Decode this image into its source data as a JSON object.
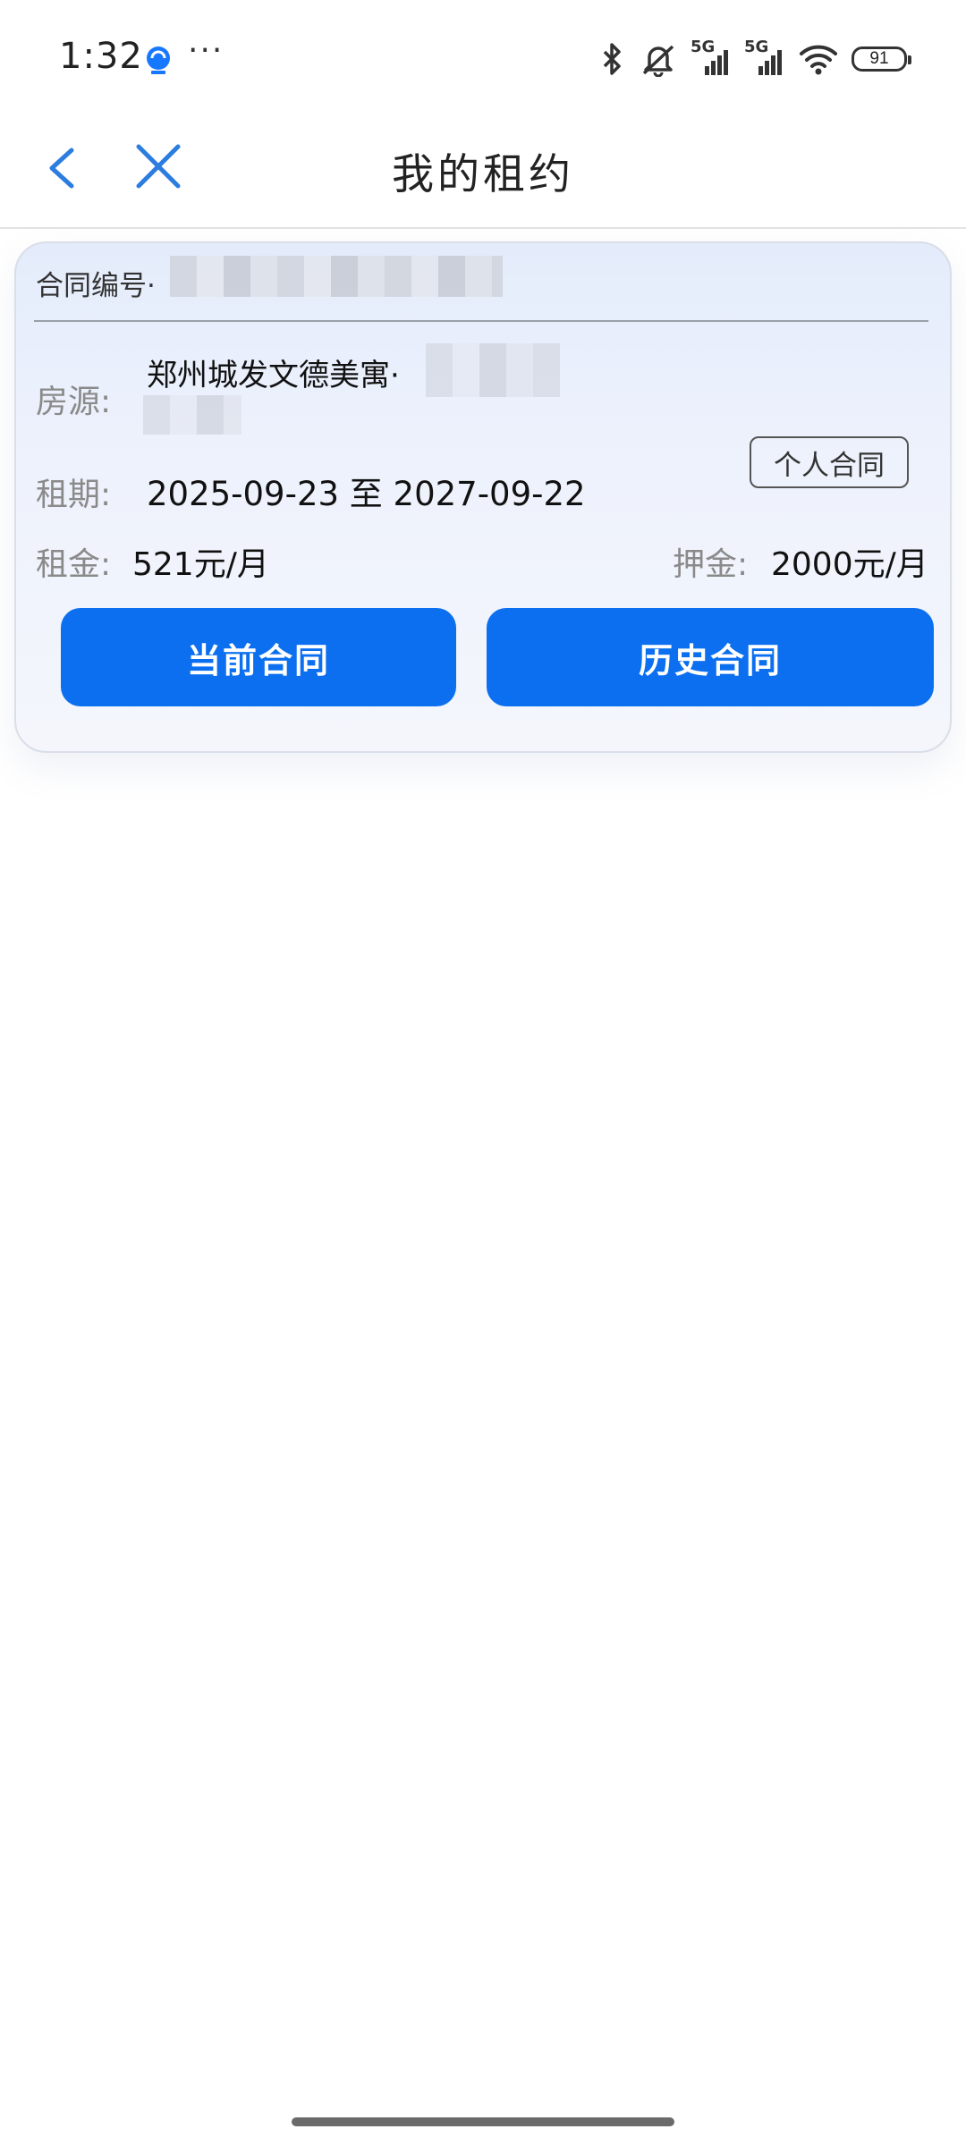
{
  "status_bar": {
    "time": "1:32",
    "app_icon": "alipay-service-icon",
    "more_dots": "···",
    "signal_1_label": "5G",
    "signal_2_label": "5G",
    "battery_level": "91"
  },
  "nav": {
    "title": "我的租约",
    "back_icon": "chevron-left-icon",
    "close_icon": "close-icon"
  },
  "contract": {
    "number_label": "合同编号·",
    "house_label": "房源:",
    "house_value": "郑州城发文德美寓·",
    "type_tag": "个人合同",
    "term_label": "租期:",
    "term_value": "2025-09-23 至 2027-09-22",
    "rent_label": "租金:",
    "rent_value": "521元/月",
    "deposit_label": "押金:",
    "deposit_value": "2000元/月"
  },
  "actions": {
    "current_label": "当前合同",
    "history_label": "历史合同"
  },
  "colors": {
    "accent": "#0b6ff0",
    "nav_icon": "#2b7de0"
  }
}
